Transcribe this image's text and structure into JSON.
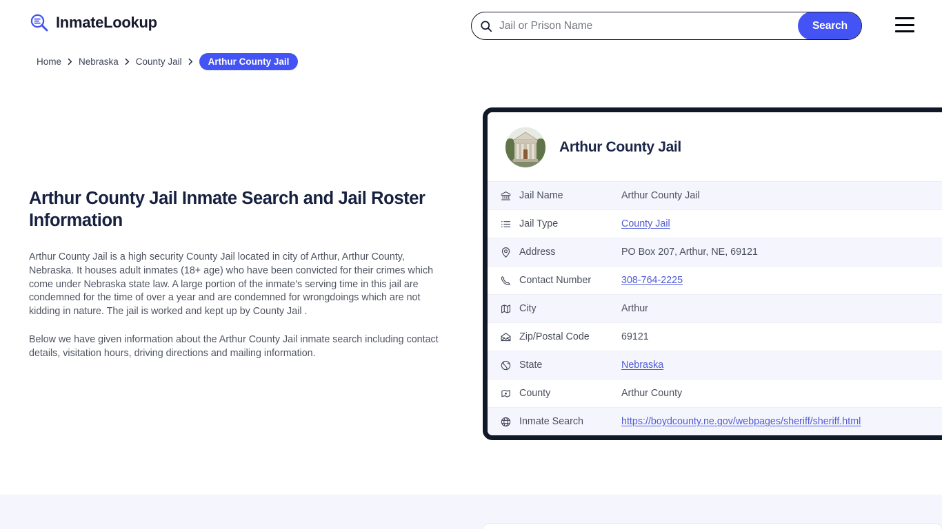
{
  "header": {
    "brand_name": "InmateLookup",
    "brand_icon": "search-list-logo-icon",
    "search": {
      "placeholder": "Jail or Prison Name",
      "value": "",
      "button_label": "Search",
      "icon": "search-icon"
    },
    "menu_icon": "hamburger-menu-icon"
  },
  "breadcrumb": {
    "items": [
      {
        "label": "Home",
        "current": false
      },
      {
        "label": "Nebraska",
        "current": false
      },
      {
        "label": "County Jail",
        "current": false
      },
      {
        "label": "Arthur County Jail",
        "current": true
      }
    ]
  },
  "main": {
    "title": "Arthur County Jail Inmate Search and Jail Roster Information",
    "paragraphs": [
      "Arthur County Jail is a high security County Jail located in city of Arthur, Arthur County, Nebraska. It houses adult inmates (18+ age) who have been convicted for their crimes which come under Nebraska state law. A large portion of the inmate's serving time in this jail are condemned for the time of over a year and are condemned for wrongdoings which are not kidding in nature. The jail is worked and kept up by County Jail .",
      "Below we have given information about the Arthur County Jail inmate search including contact details, visitation hours, driving directions and mailing information."
    ]
  },
  "card": {
    "avatar_icon": "courthouse-photo",
    "title": "Arthur County Jail",
    "rows": [
      {
        "icon": "bank-icon",
        "label": "Jail Name",
        "value": "Arthur County Jail",
        "link": false
      },
      {
        "icon": "list-icon",
        "label": "Jail Type",
        "value": "County Jail",
        "link": true
      },
      {
        "icon": "map-pin-icon",
        "label": "Address",
        "value": "PO Box 207, Arthur, NE, 69121",
        "link": false
      },
      {
        "icon": "phone-icon",
        "label": "Contact Number",
        "value": "308-764-2225",
        "link": true
      },
      {
        "icon": "map-icon",
        "label": "City",
        "value": "Arthur",
        "link": false
      },
      {
        "icon": "envelope-icon",
        "label": "Zip/Postal Code",
        "value": "69121",
        "link": false
      },
      {
        "icon": "globe-grid-icon",
        "label": "State",
        "value": "Nebraska",
        "link": true
      },
      {
        "icon": "county-map-icon",
        "label": "County",
        "value": "Arthur County",
        "link": false
      },
      {
        "icon": "globe-icon",
        "label": "Inmate Search",
        "value": "https://boydcounty.ne.gov/webpages/sheriff/sheriff.html",
        "link": true
      }
    ]
  },
  "colors": {
    "accent_blue": "#4353f4",
    "link_blue": "#4e5bd6",
    "card_border": "#111827",
    "row_alt_bg": "#f5f5fd",
    "heading": "#16203f",
    "body_text": "#4f5461"
  }
}
